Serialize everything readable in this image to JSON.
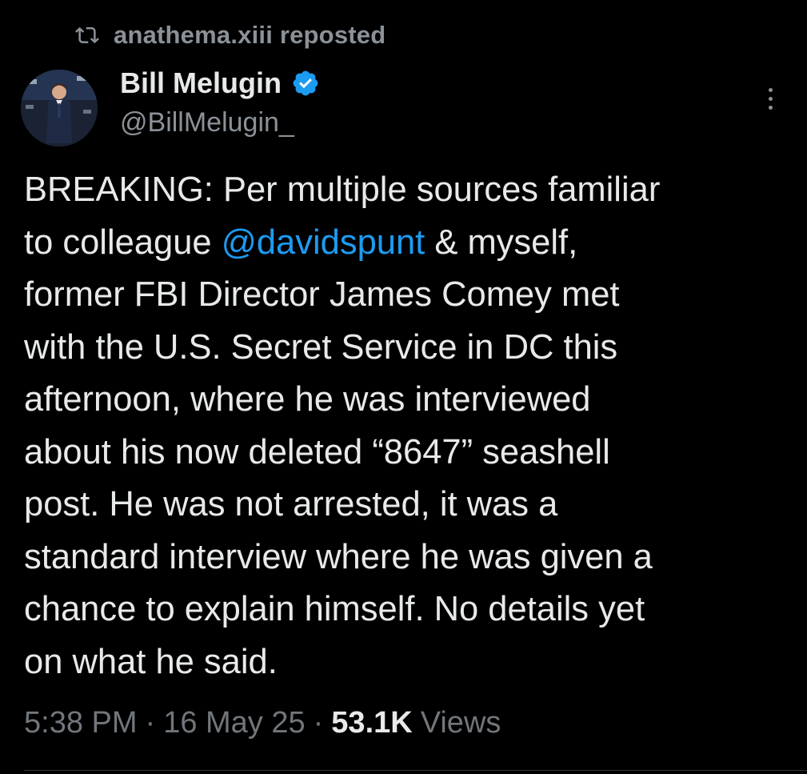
{
  "repost": {
    "icon": "repost-icon",
    "user": "anathema.xiii",
    "action": "reposted"
  },
  "author": {
    "display_name": "Bill Melugin",
    "handle": "@BillMelugin_",
    "verified_icon": "verified-badge-icon",
    "verified_color": "#1d9bf0"
  },
  "tweet": {
    "text_before_mention": "BREAKING: Per multiple sources familiar\nto colleague ",
    "mention": "@davidspunt",
    "text_after_mention": " & myself,\nformer FBI Director James Comey met\nwith the U.S. Secret Service in DC this\nafternoon, where he was interviewed\nabout his now deleted “8647” seashell\npost. He was not arrested, it was a\nstandard interview where he was given a\nchance to explain himself. No details yet\non what he said."
  },
  "meta": {
    "time": "5:38 PM",
    "separator": "·",
    "date": "16 May 25",
    "views_count": "53.1K",
    "views_label": "Views"
  },
  "colors": {
    "background": "#000000",
    "text": "#e7e9ea",
    "secondary": "#71767b",
    "link": "#1d9bf0"
  }
}
